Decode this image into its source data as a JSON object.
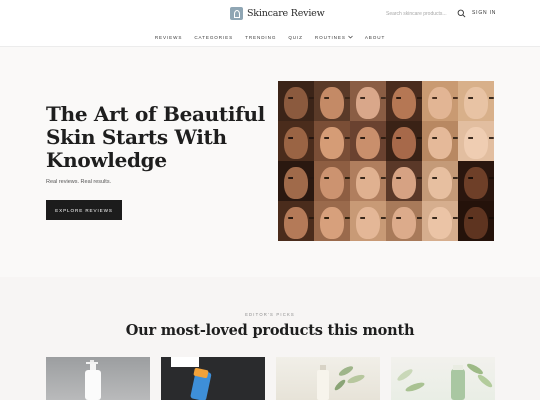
{
  "header": {
    "logo_text": "Skincare Review",
    "search_placeholder": "Search skincare products...",
    "signin_label": "SIGN IN"
  },
  "nav": {
    "items": [
      "REVIEWS",
      "CATEGORIES",
      "TRENDING",
      "QUIZ",
      "ROUTINES",
      "ABOUT"
    ]
  },
  "hero": {
    "title": "The Art of Beautiful Skin Starts With Knowledge",
    "subtitle": "Real reviews. Real results.",
    "cta_label": "EXPLORE REVIEWS"
  },
  "section": {
    "eyebrow": "EDITOR'S PICKS",
    "title": "Our most-loved products this month"
  },
  "colors": {
    "accent": "#8fa6b4",
    "cta_bg": "#1c1c1c",
    "hero_bg": "#faf9f8",
    "section_bg": "#f7f5f4"
  }
}
